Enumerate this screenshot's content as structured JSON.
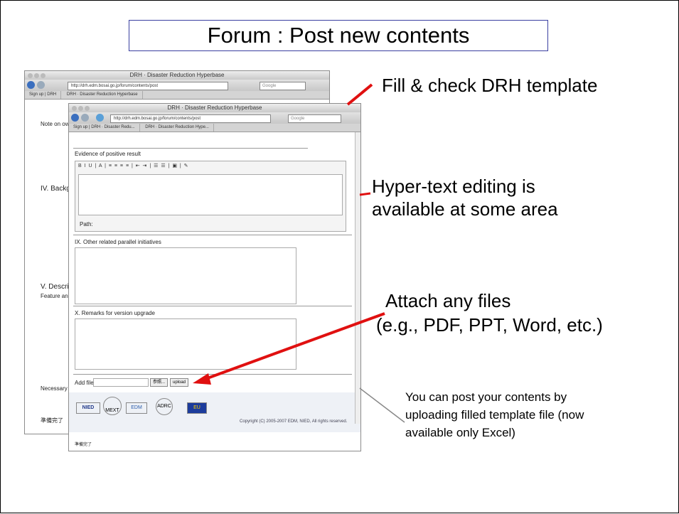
{
  "slide": {
    "title": "Forum : Post new contents"
  },
  "callouts": {
    "fill_check": "Fill & check DRH template",
    "hypertext_1": "Hyper-text editing is",
    "hypertext_2": "available at some area",
    "attach_1": "Attach any files",
    "attach_2": "(e.g., PDF, PPT, Word, etc.)",
    "upload_note_1": "You can post your contents by",
    "upload_note_2": "uploading filled template file (now",
    "upload_note_3": "available only Excel)"
  },
  "back_window": {
    "title": "DRH · Disaster Reduction Hyperbase",
    "url": "http://drh.edm.bosai.go.jp/forum/contents/post",
    "search": "Google",
    "tabs": [
      "Sign up | DRH",
      "DRH · Disaster Reduction Hyperbase"
    ],
    "side_text": [
      "Note on owners",
      "IV. Backgro",
      "V. Descript",
      "Feature and ad",
      "Necessary proc"
    ],
    "status": "準備完了"
  },
  "front_window": {
    "title": "DRH · Disaster Reduction Hyperbase",
    "url": "http://drh.edm.bosai.go.jp/forum/contents/post",
    "search": "Google",
    "tabs": [
      "Sign up | DRH · Disaster Redu...",
      "DRH · Disaster Reduction Hype..."
    ],
    "evidence_label": "Evidence of positive result",
    "path_label": "Path:",
    "section_ix": "IX. Other related parallel initiatives",
    "section_x": "X. Remarks for version upgrade",
    "add_file_label": "Add file",
    "browse_button": "参照...",
    "upload_button": "upload",
    "logos": [
      "NIED",
      "MEXT",
      "EDM",
      "ADRC",
      "EU"
    ],
    "copyright": "Copyright (C) 2005-2007 EDM, NIED, All rights reserved.",
    "status": "準備完了"
  },
  "colors": {
    "arrow": "#e01010",
    "title_border": "#3a3fa0"
  }
}
